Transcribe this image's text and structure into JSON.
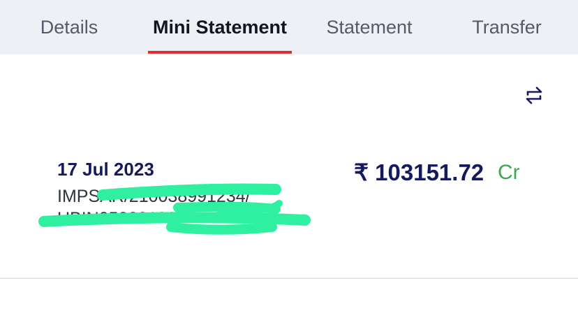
{
  "tabs": [
    {
      "label": "Details"
    },
    {
      "label": "Mini Statement",
      "active": true
    },
    {
      "label": "Statement"
    },
    {
      "label": "Transfer"
    }
  ],
  "toolbar": {
    "refresh_icon": "swap-arrows-icon"
  },
  "statement": {
    "entries": [
      {
        "date": "17 Jul 2023",
        "description": "IMPSAR/210038991234/ UBIN052001837654321",
        "amount": "₹ 103151.72",
        "type": "Cr"
      }
    ]
  },
  "colors": {
    "accent": "#e02f2f",
    "navy": "#141a5c",
    "credit": "#3daa4a",
    "tabbar_bg": "#eef0f6",
    "redaction": "#2ef0a0"
  }
}
